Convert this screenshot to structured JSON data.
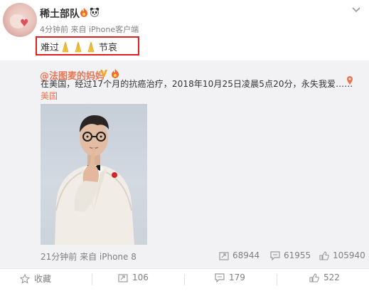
{
  "post": {
    "username": "稀土部队",
    "meta": "4分钟前 来自 iPhone客户端",
    "text_before": "难过",
    "text_after": "节哀",
    "pray_count": 3
  },
  "repost": {
    "username": "@法图麦的妈妈",
    "text": "在美国，经过17个月的抗癌治疗，2018年10月25日凌晨5点20分，永失我爱……",
    "location": "美国",
    "time_source": "21分钟前 来自 iPhone 8",
    "forward_count": "68944",
    "comment_count": "61955",
    "like_count": "105940"
  },
  "actions": {
    "favorite": "收藏",
    "forward": "106",
    "comment": "179",
    "like": "522"
  },
  "colors": {
    "link_orange": "#eb7350",
    "highlight_red": "#e02020",
    "repost_bg": "#f2f2f5",
    "muted_text": "#808080"
  },
  "icons": [
    "fire-badge-icon",
    "panda-badge-icon",
    "chevron-down-icon",
    "pray-emoji-icon",
    "verified-v-icon",
    "location-pin-icon",
    "forward-icon",
    "comment-icon",
    "like-icon",
    "star-icon"
  ]
}
